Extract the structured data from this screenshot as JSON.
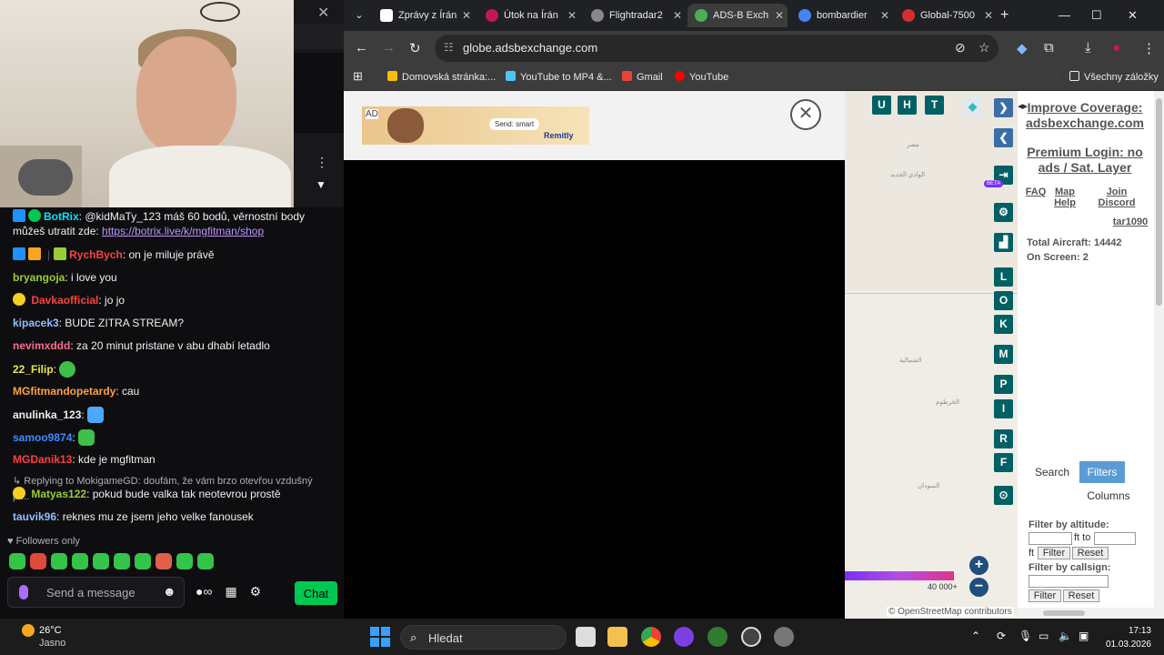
{
  "twitch": {
    "messages": [
      {
        "user": "BotRix",
        "user_color": "#00e5ff",
        "text": ": @kidMaTy_123 máš 60 bodů, věrnostní body můžeš utratit zde: ",
        "link": "https://botrix.live/k/mgfitman/shop"
      },
      {
        "user": "RychBych",
        "user_color": "#ff4040",
        "text": ": on je miluje právě"
      },
      {
        "user": "bryangoja",
        "user_color": "#9acd32",
        "text": ": i love you"
      },
      {
        "user": "Davkaofficial",
        "user_color": "#ff4040",
        "text": ": jo jo"
      },
      {
        "user": "kipacek3",
        "user_color": "#8fbfff",
        "text": ": BUDE ZITRA STREAM?"
      },
      {
        "user": "nevimxddd",
        "user_color": "#ff6b8b",
        "text": ": za 20 minut pristane v abu dhabí letadlo"
      },
      {
        "user": "22_Filip",
        "user_color": "#e6e64d",
        "text": ":"
      },
      {
        "user": "MGfitmandopetardy",
        "user_color": "#ffa040",
        "text": ": cau"
      },
      {
        "user": "anulinka_123",
        "user_color": "#efeff1",
        "text": ":"
      },
      {
        "user": "samoo9874",
        "user_color": "#3d8bff",
        "text": ":"
      },
      {
        "user": "MGDanik13",
        "user_color": "#ff4040",
        "text": ": kde je mgfitman"
      },
      {
        "user": "Matyas122",
        "user_color": "#9acd32",
        "text": ": pokud bude valka tak neotevrou prostě"
      },
      {
        "user": "tauvik96",
        "user_color": "#8fbfff",
        "text": ": reknes mu ze jsem jeho velke fanousek"
      }
    ],
    "reply_text": "Replying to MokigameGD: doufám, že vám brzo otevřou vzdušný pr...",
    "followers_only": "Followers only",
    "input_placeholder": "Send a message",
    "chat_button": "Chat"
  },
  "browser": {
    "tabs": [
      {
        "label": "Zprávy z Írán",
        "color": "#ffffff"
      },
      {
        "label": "Útok na Írán",
        "color": "#c2185b"
      },
      {
        "label": "Flightradar2",
        "color": "#888888"
      },
      {
        "label": "ADS-B Exch",
        "color": "#4caf50"
      },
      {
        "label": "bombardier",
        "color": "#4285f4"
      },
      {
        "label": "Global-7500",
        "color": "#d32f2f"
      }
    ],
    "url": "globe.adsbexchange.com",
    "bookmarks": [
      {
        "label": "Domovská stránka:...",
        "color": "#fbbc04"
      },
      {
        "label": "YouTube to MP4 &...",
        "color": "#4fc3f7"
      },
      {
        "label": "Gmail",
        "color": "#ea4335"
      },
      {
        "label": "YouTube",
        "color": "#ff0000"
      }
    ],
    "all_bookmarks": "Všechny záložky"
  },
  "ad": {
    "tag": "AD",
    "send": "Send: smart",
    "brand": "Remitly"
  },
  "map": {
    "top_buttons": [
      "U",
      "H",
      "T"
    ],
    "letter_buttons": [
      "L",
      "O",
      "K",
      "M",
      "P",
      "I",
      "R",
      "F"
    ],
    "beta": "BETA",
    "altitude_label": "40 000+",
    "attribution": "© OpenStreetMap contributors",
    "labels": [
      {
        "text": "مصر"
      },
      {
        "text": "الوادي الجديد"
      },
      {
        "text": "الشمالية"
      },
      {
        "text": "السودان"
      },
      {
        "text": "الخرطوم"
      }
    ]
  },
  "sidebar": {
    "improve_coverage": "Improve Coverage: adsbexchange.com",
    "premium": "Premium Login: no ads / Sat. Layer",
    "faq": "FAQ",
    "map_help": "Map Help",
    "join_discord": "Join Discord",
    "user": "tar1090",
    "total_aircraft": "Total Aircraft: 14442",
    "on_screen": "On Screen: 2",
    "search_tab": "Search",
    "filters_tab": "Filters",
    "columns_tab": "Columns",
    "filter_altitude": "Filter by altitude:",
    "ft_to": "ft to",
    "ft": "ft",
    "filter_btn": "Filter",
    "reset_btn": "Reset",
    "filter_callsign": "Filter by callsign:"
  },
  "taskbar": {
    "temperature": "26°C",
    "weather": "Jasno",
    "search_placeholder": "Hledat",
    "time": "17:13",
    "date": "01.03.2026"
  },
  "colors": {
    "twitch_bg": "#0e0e10",
    "chat_green": "#00c853",
    "map_button": "#006064",
    "filters_active": "#5b9bd5"
  }
}
